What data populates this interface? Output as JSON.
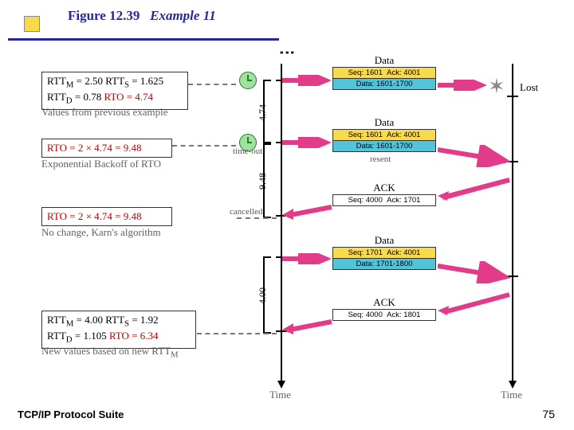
{
  "title": {
    "fig": "Figure 12.39",
    "ex": "Example 11"
  },
  "boxA": {
    "l1a": "RTT",
    "l1b": "M",
    "l1c": " = 2.50 RTT",
    "l1d": "S",
    "l1e": " = 1.625",
    "l2a": "RTT",
    "l2b": "D",
    "l2c": " = 0.78 ",
    "l2d": "RTO = 4.74"
  },
  "capA": "Values from previous example",
  "boxB": {
    "l1": "RTO = 2 × 4.74 = 9.48"
  },
  "capB": "Exponential Backoff of RTO",
  "boxC": {
    "l1": "RTO = 2 × 4.74 = 9.48"
  },
  "capC": "No change, Karn's algorithm",
  "boxD": {
    "l1a": "RTT",
    "l1b": "M",
    "l1c": " = 4.00 RTT",
    "l1d": "S",
    "l1e": " = 1.92",
    "l2a": "RTT",
    "l2b": "D",
    "l2c": " = 1.105 ",
    "l2d": "RTO = 6.34"
  },
  "capD": "New values based on new RTT",
  "capDsub": "M",
  "p1": {
    "seq": "Seq: 1601",
    "ack": "Ack: 4001",
    "data": "Data: 1601-1700",
    "label": "Data"
  },
  "p2": {
    "seq": "Seq: 1601",
    "ack": "Ack: 4001",
    "data": "Data: 1601-1700",
    "label": "Data",
    "resent": "resent"
  },
  "p3": {
    "seq": "Seq: 4000",
    "ack": "Ack: 1701",
    "label": "ACK"
  },
  "p4": {
    "seq": "Seq: 1701",
    "ack": "Ack: 4001",
    "data": "Data: 1701-1800",
    "label": "Data"
  },
  "p5": {
    "seq": "Seq: 4000",
    "ack": "Ack: 1801",
    "label": "ACK"
  },
  "brackets": {
    "b1": "4.74",
    "b2": "9.48",
    "b3": "4.00"
  },
  "txt": {
    "timeout": "time-out",
    "cancelled": "cancelled",
    "lost": "Lost",
    "time": "Time"
  },
  "footer": "TCP/IP Protocol Suite",
  "page": "75"
}
